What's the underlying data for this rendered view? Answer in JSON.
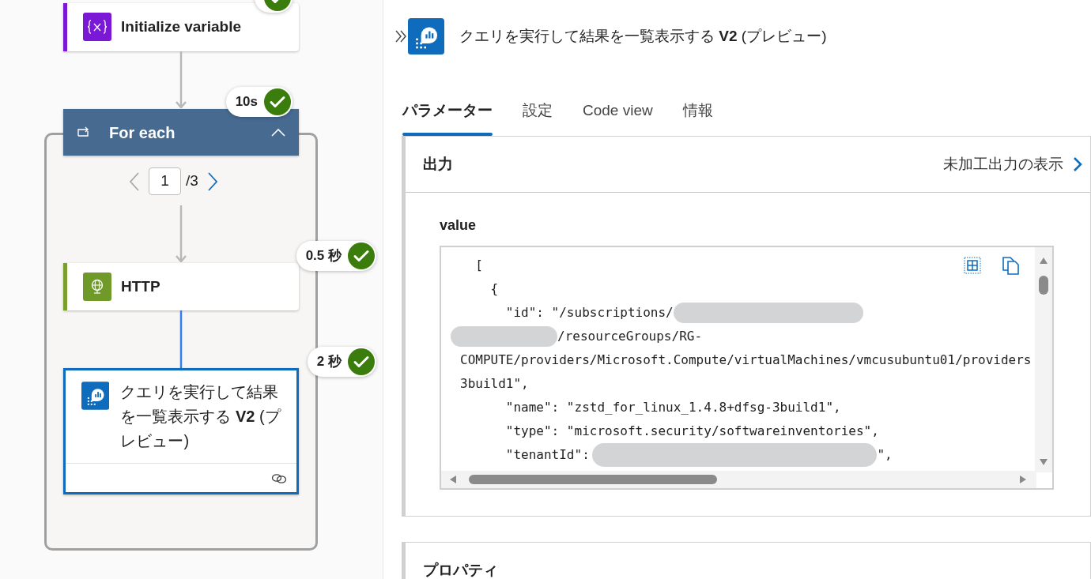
{
  "flow": {
    "nodes": [
      {
        "kind": "variable",
        "title": "Initialize variable"
      },
      {
        "kind": "foreach",
        "title": "For each",
        "badge": "10s",
        "expanded": true,
        "pager": {
          "value": "1",
          "total": "/3"
        },
        "children": [
          {
            "kind": "http",
            "title": "HTTP",
            "badge": "0.5 秒",
            "selected": false
          },
          {
            "kind": "query",
            "title": "クエリを実行して結果を一覧表示する **V2** (プレビュー)",
            "badge": "2 秒",
            "selected": true
          }
        ]
      }
    ]
  },
  "panel": {
    "title": "クエリを実行して結果を一覧表示する **V2** (プレビュー)",
    "tabs": [
      {
        "label": "パラメーター",
        "selected": true
      },
      {
        "label": "設定",
        "selected": false
      },
      {
        "label": "Code view",
        "selected": false
      },
      {
        "label": "情報",
        "selected": false
      }
    ],
    "sections": [
      {
        "title": "出力",
        "link": "未加工出力の表示",
        "field_label": "value",
        "code_lines": [
          [
            {
              "kind": "text",
              "text": "  ["
            }
          ],
          [
            {
              "kind": "text",
              "text": "    {"
            }
          ],
          [
            {
              "kind": "text",
              "text": "      \"id\": \"/subscriptions/"
            },
            {
              "kind": "redaction"
            }
          ],
          [
            {
              "kind": "redaction"
            },
            {
              "kind": "text",
              "text": "/resourceGroups/RG-"
            }
          ],
          [
            {
              "kind": "text",
              "text": "COMPUTE/providers/Microsoft.Compute/virtualMachines/vmcusubuntu01/providers"
            }
          ],
          [
            {
              "kind": "text",
              "text": "3build1\","
            }
          ],
          [
            {
              "kind": "text",
              "text": "      \"name\": \"zstd_for_linux_1.4.8+dfsg-3build1\","
            }
          ],
          [
            {
              "kind": "text",
              "text": "      \"type\": \"microsoft.security/softwareinventories\","
            }
          ],
          [
            {
              "kind": "text",
              "text": "      \"tenantId\": "
            },
            {
              "kind": "redaction"
            },
            {
              "kind": "text",
              "text": "\","
            }
          ]
        ]
      },
      {
        "title": "プロパティ"
      }
    ]
  }
}
